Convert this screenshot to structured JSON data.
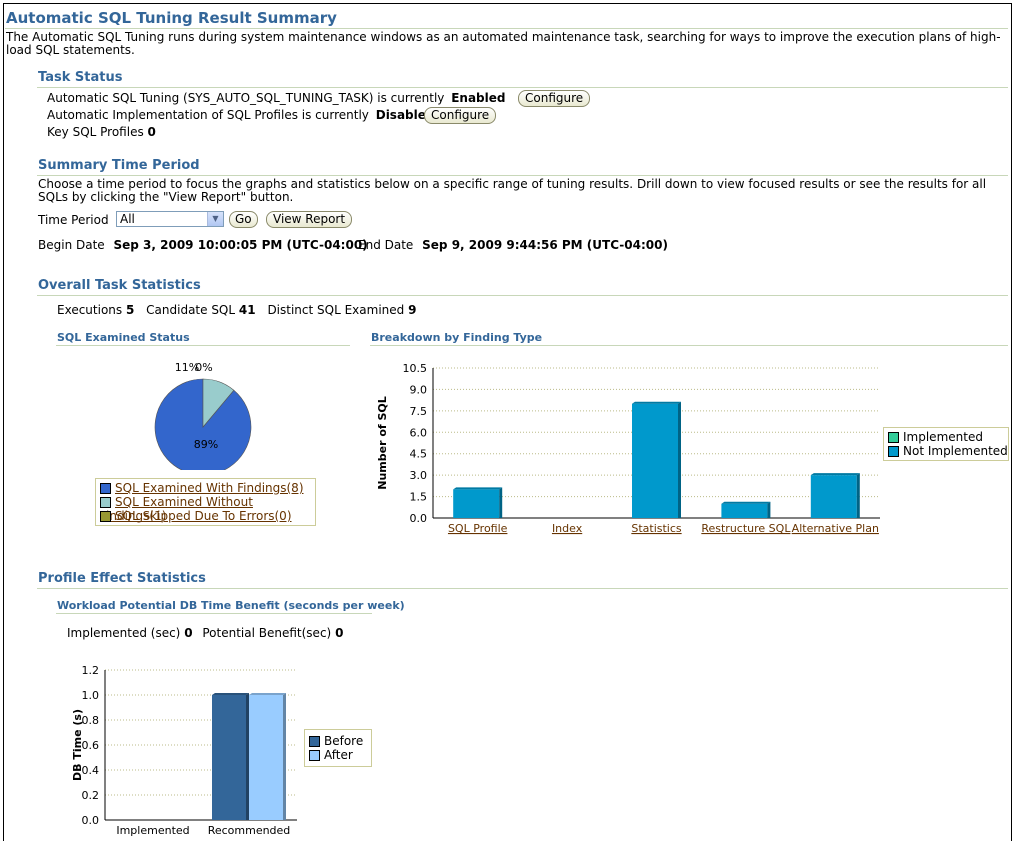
{
  "page": {
    "title": "Automatic SQL Tuning Result Summary",
    "description": "The Automatic SQL Tuning runs during system maintenance windows as an automated maintenance task, searching for ways to improve the execution plans of high-load SQL statements."
  },
  "task_status": {
    "heading": "Task Status",
    "line1_text": "Automatic SQL Tuning (SYS_AUTO_SQL_TUNING_TASK) is currently",
    "line1_value": "Enabled",
    "line2_text": "Automatic Implementation of SQL Profiles is currently",
    "line2_value": "Disabled",
    "line3_text": "Key SQL Profiles",
    "line3_value": "0",
    "configure_label": "Configure"
  },
  "summary_period": {
    "heading": "Summary Time Period",
    "description": "Choose a time period to focus the graphs and statistics below on a specific range of tuning results. Drill down to view focused results or see the results for all SQLs by clicking the \"View Report\" button.",
    "time_period_label": "Time Period",
    "time_period_value": "All",
    "go_label": "Go",
    "view_report_label": "View Report",
    "begin_label": "Begin Date",
    "begin_value": "Sep 3, 2009 10:00:05 PM (UTC-04:00)",
    "end_label": "End Date",
    "end_value": "Sep 9, 2009 9:44:56 PM (UTC-04:00)"
  },
  "overall": {
    "heading": "Overall Task Statistics",
    "executions_label": "Executions",
    "executions_value": "5",
    "candidate_label": "Candidate SQL",
    "candidate_value": "41",
    "distinct_label": "Distinct SQL Examined",
    "distinct_value": "9",
    "examined_status_title": "SQL Examined Status",
    "breakdown_title": "Breakdown by Finding Type"
  },
  "profile_effect": {
    "heading": "Profile Effect Statistics",
    "workload_title": "Workload Potential DB Time Benefit (seconds per week)",
    "implemented_label": "Implemented (sec)",
    "implemented_value": "0",
    "potential_label": "Potential Benefit(sec)",
    "potential_value": "0"
  },
  "chart_data": [
    {
      "type": "pie",
      "title": "SQL Examined Status",
      "labels": [
        "SQL Examined With Findings(8)",
        "SQL Examined Without Findings(1)",
        "SQL Skipped Due To Errors(0)"
      ],
      "values": [
        8,
        1,
        0
      ],
      "slice_labels": [
        "89%",
        "11%",
        "0%"
      ],
      "colors": [
        "#3366cc",
        "#99cccc",
        "#999933"
      ],
      "legend": "bottom"
    },
    {
      "type": "bar",
      "title": "Breakdown by Finding Type",
      "categories": [
        "SQL Profile",
        "Index",
        "Statistics",
        "Restructure SQL",
        "Alternative Plan"
      ],
      "series": [
        {
          "name": "Implemented",
          "values": [
            0,
            0,
            0,
            0,
            0
          ],
          "color": "#33cc99"
        },
        {
          "name": "Not Implemented",
          "values": [
            2,
            0,
            8,
            1,
            3
          ],
          "color": "#0099cc"
        }
      ],
      "ylabel": "Number of SQL",
      "ylim": [
        0,
        10.5
      ],
      "yticks": [
        "0.0",
        "1.5",
        "3.0",
        "4.5",
        "6.0",
        "7.5",
        "9.0",
        "10.5"
      ],
      "legend": "right"
    },
    {
      "type": "bar",
      "title": "Workload Potential DB Time Benefit (seconds per week)",
      "categories": [
        "Implemented",
        "Recommended"
      ],
      "series": [
        {
          "name": "Before",
          "values": [
            0,
            1.0
          ],
          "color": "#336699"
        },
        {
          "name": "After",
          "values": [
            0,
            1.0
          ],
          "color": "#99ccff"
        }
      ],
      "ylabel": "DB Time (s)",
      "ylim": [
        0,
        1.2
      ],
      "yticks": [
        "0.0",
        "0.2",
        "0.4",
        "0.6",
        "0.8",
        "1.0",
        "1.2"
      ],
      "legend": "right"
    }
  ]
}
